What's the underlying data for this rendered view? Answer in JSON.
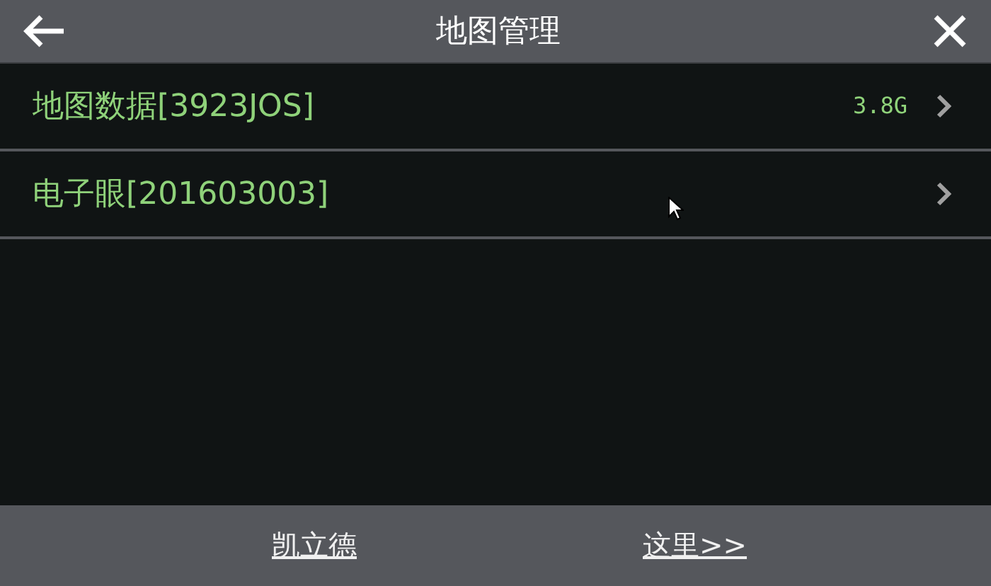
{
  "header": {
    "title": "地图管理"
  },
  "items": [
    {
      "label": "地图数据[3923JOS]",
      "value": "3.8G"
    },
    {
      "label": "电子眼[201603003]"
    }
  ],
  "footer": {
    "link_parts": [
      "凯立德",
      "这里>>"
    ]
  }
}
